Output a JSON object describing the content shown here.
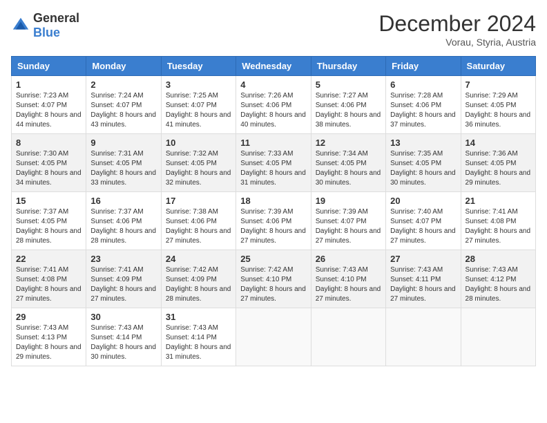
{
  "logo": {
    "general": "General",
    "blue": "Blue"
  },
  "header": {
    "title": "December 2024",
    "subtitle": "Vorau, Styria, Austria"
  },
  "weekdays": [
    "Sunday",
    "Monday",
    "Tuesday",
    "Wednesday",
    "Thursday",
    "Friday",
    "Saturday"
  ],
  "weeks": [
    [
      {
        "day": "1",
        "sunrise": "7:23 AM",
        "sunset": "4:07 PM",
        "daylight": "8 hours and 44 minutes."
      },
      {
        "day": "2",
        "sunrise": "7:24 AM",
        "sunset": "4:07 PM",
        "daylight": "8 hours and 43 minutes."
      },
      {
        "day": "3",
        "sunrise": "7:25 AM",
        "sunset": "4:07 PM",
        "daylight": "8 hours and 41 minutes."
      },
      {
        "day": "4",
        "sunrise": "7:26 AM",
        "sunset": "4:06 PM",
        "daylight": "8 hours and 40 minutes."
      },
      {
        "day": "5",
        "sunrise": "7:27 AM",
        "sunset": "4:06 PM",
        "daylight": "8 hours and 38 minutes."
      },
      {
        "day": "6",
        "sunrise": "7:28 AM",
        "sunset": "4:06 PM",
        "daylight": "8 hours and 37 minutes."
      },
      {
        "day": "7",
        "sunrise": "7:29 AM",
        "sunset": "4:05 PM",
        "daylight": "8 hours and 36 minutes."
      }
    ],
    [
      {
        "day": "8",
        "sunrise": "7:30 AM",
        "sunset": "4:05 PM",
        "daylight": "8 hours and 34 minutes."
      },
      {
        "day": "9",
        "sunrise": "7:31 AM",
        "sunset": "4:05 PM",
        "daylight": "8 hours and 33 minutes."
      },
      {
        "day": "10",
        "sunrise": "7:32 AM",
        "sunset": "4:05 PM",
        "daylight": "8 hours and 32 minutes."
      },
      {
        "day": "11",
        "sunrise": "7:33 AM",
        "sunset": "4:05 PM",
        "daylight": "8 hours and 31 minutes."
      },
      {
        "day": "12",
        "sunrise": "7:34 AM",
        "sunset": "4:05 PM",
        "daylight": "8 hours and 30 minutes."
      },
      {
        "day": "13",
        "sunrise": "7:35 AM",
        "sunset": "4:05 PM",
        "daylight": "8 hours and 30 minutes."
      },
      {
        "day": "14",
        "sunrise": "7:36 AM",
        "sunset": "4:05 PM",
        "daylight": "8 hours and 29 minutes."
      }
    ],
    [
      {
        "day": "15",
        "sunrise": "7:37 AM",
        "sunset": "4:05 PM",
        "daylight": "8 hours and 28 minutes."
      },
      {
        "day": "16",
        "sunrise": "7:37 AM",
        "sunset": "4:06 PM",
        "daylight": "8 hours and 28 minutes."
      },
      {
        "day": "17",
        "sunrise": "7:38 AM",
        "sunset": "4:06 PM",
        "daylight": "8 hours and 27 minutes."
      },
      {
        "day": "18",
        "sunrise": "7:39 AM",
        "sunset": "4:06 PM",
        "daylight": "8 hours and 27 minutes."
      },
      {
        "day": "19",
        "sunrise": "7:39 AM",
        "sunset": "4:07 PM",
        "daylight": "8 hours and 27 minutes."
      },
      {
        "day": "20",
        "sunrise": "7:40 AM",
        "sunset": "4:07 PM",
        "daylight": "8 hours and 27 minutes."
      },
      {
        "day": "21",
        "sunrise": "7:41 AM",
        "sunset": "4:08 PM",
        "daylight": "8 hours and 27 minutes."
      }
    ],
    [
      {
        "day": "22",
        "sunrise": "7:41 AM",
        "sunset": "4:08 PM",
        "daylight": "8 hours and 27 minutes."
      },
      {
        "day": "23",
        "sunrise": "7:41 AM",
        "sunset": "4:09 PM",
        "daylight": "8 hours and 27 minutes."
      },
      {
        "day": "24",
        "sunrise": "7:42 AM",
        "sunset": "4:09 PM",
        "daylight": "8 hours and 28 minutes."
      },
      {
        "day": "25",
        "sunrise": "7:42 AM",
        "sunset": "4:10 PM",
        "daylight": "8 hours and 27 minutes."
      },
      {
        "day": "26",
        "sunrise": "7:43 AM",
        "sunset": "4:10 PM",
        "daylight": "8 hours and 27 minutes."
      },
      {
        "day": "27",
        "sunrise": "7:43 AM",
        "sunset": "4:11 PM",
        "daylight": "8 hours and 27 minutes."
      },
      {
        "day": "28",
        "sunrise": "7:43 AM",
        "sunset": "4:12 PM",
        "daylight": "8 hours and 28 minutes."
      }
    ],
    [
      {
        "day": "29",
        "sunrise": "7:43 AM",
        "sunset": "4:13 PM",
        "daylight": "8 hours and 29 minutes."
      },
      {
        "day": "30",
        "sunrise": "7:43 AM",
        "sunset": "4:14 PM",
        "daylight": "8 hours and 30 minutes."
      },
      {
        "day": "31",
        "sunrise": "7:43 AM",
        "sunset": "4:14 PM",
        "daylight": "8 hours and 31 minutes."
      },
      null,
      null,
      null,
      null
    ]
  ],
  "labels": {
    "sunrise": "Sunrise:",
    "sunset": "Sunset:",
    "daylight": "Daylight:"
  }
}
